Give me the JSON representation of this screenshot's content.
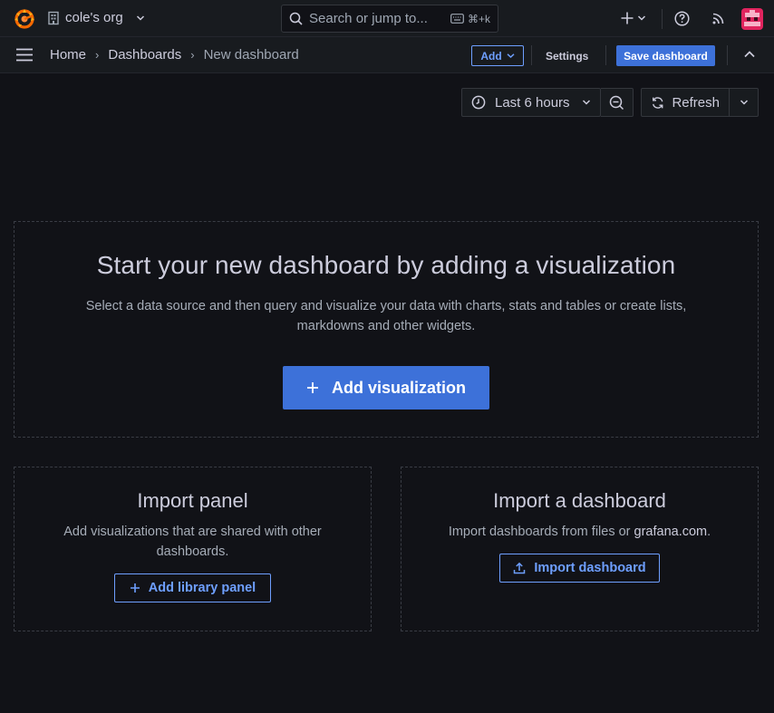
{
  "topbar": {
    "org_name": "cole's org",
    "search_placeholder": "Search or jump to...",
    "search_shortcut": "⌘+k"
  },
  "navbar": {
    "breadcrumbs": [
      "Home",
      "Dashboards",
      "New dashboard"
    ],
    "add_label": "Add",
    "settings_label": "Settings",
    "save_label": "Save dashboard"
  },
  "controls": {
    "time_range": "Last 6 hours",
    "refresh_label": "Refresh"
  },
  "empty_state": {
    "title": "Start your new dashboard by adding a visualization",
    "description": "Select a data source and then query and visualize your data with charts, stats and tables or create lists, markdowns and other widgets.",
    "add_viz_label": "Add visualization"
  },
  "import_panel": {
    "title": "Import panel",
    "description": "Add visualizations that are shared with other dashboards.",
    "button_label": "Add library panel"
  },
  "import_dashboard": {
    "title": "Import a dashboard",
    "description_prefix": "Import dashboards from files or ",
    "description_link": "grafana.com",
    "description_suffix": ".",
    "button_label": "Import dashboard"
  },
  "colors": {
    "background": "#111217",
    "primary": "#3d71d9",
    "link": "#6e9fff",
    "brand_orange": "#f46800"
  },
  "icons": [
    "grafana-logo-icon",
    "building-icon",
    "search-icon",
    "keyboard-icon",
    "plus-icon",
    "help-icon",
    "rss-icon",
    "menu-icon",
    "clock-icon",
    "zoom-out-icon",
    "sync-icon",
    "upload-icon",
    "chevron-down-icon",
    "chevron-up-icon",
    "chevron-right-icon"
  ]
}
